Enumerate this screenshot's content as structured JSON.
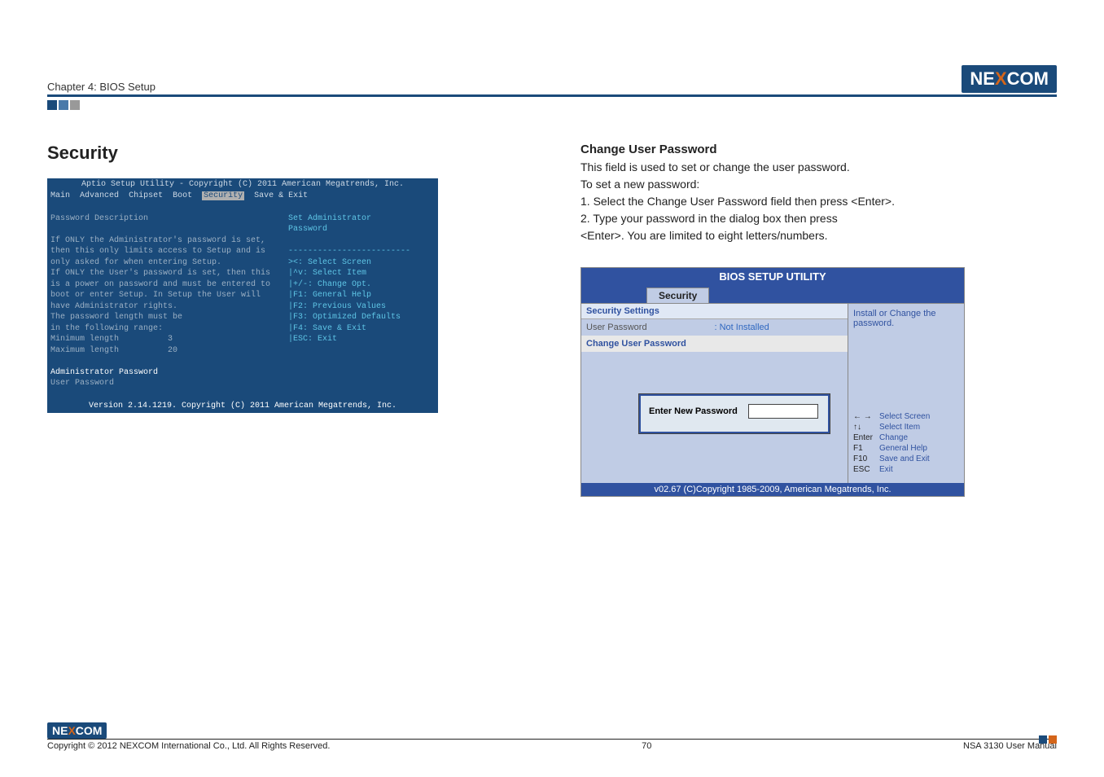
{
  "header": {
    "chapter": "Chapter 4: BIOS Setup",
    "logo": "NEXCOM"
  },
  "left": {
    "title": "Security",
    "aptio": {
      "title": "Aptio Setup Utility - Copyright (C) 2011 American Megatrends, Inc.",
      "menu": [
        "Main",
        "Advanced",
        "Chipset",
        "Boot",
        "Security",
        "Save & Exit"
      ],
      "body_left": "Password Description\n\nIf ONLY the Administrator's password is set,\nthen this only limits access to Setup and is\nonly asked for when entering Setup.\nIf ONLY the User's password is set, then this\nis a power on password and must be entered to\nboot or enter Setup. In Setup the User will\nhave Administrator rights.\nThe password length must be\nin the following range:\nMinimum length          3\nMaximum length          20\n",
      "admin_pw": "Administrator Password",
      "user_pw": "User Password",
      "right_top": "Set Administrator\nPassword",
      "right_keys": "><: Select Screen\n|^v: Select Item\n|+/-: Change Opt.\n|F1: General Help\n|F2: Previous Values\n|F3: Optimized Defaults\n|F4: Save & Exit\n|ESC: Exit",
      "footer": "Version 2.14.1219. Copyright (C) 2011 American Megatrends, Inc."
    }
  },
  "right": {
    "heading": "Change User Password",
    "p1": "This field is used to set or change the user password.",
    "p2": "To set a new password:",
    "step1": "1. Select the Change User Password field then press <Enter>.",
    "step2": "2. Type your password in the dialog box then press",
    "step2b": "<Enter>. You are limited to eight letters/numbers.",
    "gbios": {
      "title": "BIOS SETUP UTILITY",
      "tab": "Security",
      "section": "Security Settings",
      "row1_label": "User Password",
      "row1_value": ": Not Installed",
      "row2_label": "Change User Password",
      "side_help": "Install or Change the password.",
      "popup_title": "Enter New Password",
      "keys": [
        {
          "k": "← →",
          "d": "Select Screen"
        },
        {
          "k": "↑↓",
          "d": "Select Item"
        },
        {
          "k": "Enter",
          "d": "Change"
        },
        {
          "k": "F1",
          "d": "General Help"
        },
        {
          "k": "F10",
          "d": "Save and Exit"
        },
        {
          "k": "ESC",
          "d": "Exit"
        }
      ],
      "footer": "v02.67 (C)Copyright 1985-2009, American Megatrends, Inc."
    }
  },
  "footer": {
    "copyright": "Copyright © 2012 NEXCOM International Co., Ltd. All Rights Reserved.",
    "page": "70",
    "manual": "NSA 3130 User Manual"
  }
}
